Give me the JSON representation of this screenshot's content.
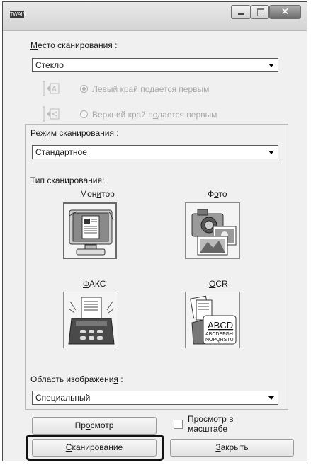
{
  "window": {
    "app_icon_text": "TWAIN"
  },
  "scan_location": {
    "label_prefix": "М",
    "label_rest": "есто сканирования :",
    "value": "Стекло",
    "option_left_pre": "Л",
    "option_left_rest": "евый край подается первым",
    "option_top_pre": "Верхний край п",
    "option_top_u": "о",
    "option_top_rest": "дается первым"
  },
  "scan_mode": {
    "label_pre": "Ре",
    "label_u": "ж",
    "label_rest": "им сканирования :",
    "value": "Стандартное"
  },
  "scan_type": {
    "label": "Тип сканирования:",
    "monitor_pre": "Мон",
    "monitor_u": "и",
    "monitor_rest": "тор",
    "photo_pre": "Ф",
    "photo_u": "о",
    "photo_rest": "то",
    "fax_u": "Ф",
    "fax_rest": "АКС",
    "ocr_u": "O",
    "ocr_rest": "CR",
    "ocr_icon_big": "ABCD",
    "ocr_icon_line1": "ABCDEFGH",
    "ocr_icon_line2": "NOPQRSTU"
  },
  "image_area": {
    "label_pre": "Область изображени",
    "label_u": "я",
    "label_rest": " :",
    "value": "Специальный"
  },
  "buttons": {
    "preview_pre": "Пр",
    "preview_u": "о",
    "preview_rest": "смотр",
    "zoom_preview_line1_pre": "Просмотр ",
    "zoom_preview_line1_u": "в",
    "zoom_preview_line2": "масштабе",
    "scan_u": "С",
    "scan_rest": "канирование",
    "close_u": "З",
    "close_rest": "акрыть"
  }
}
